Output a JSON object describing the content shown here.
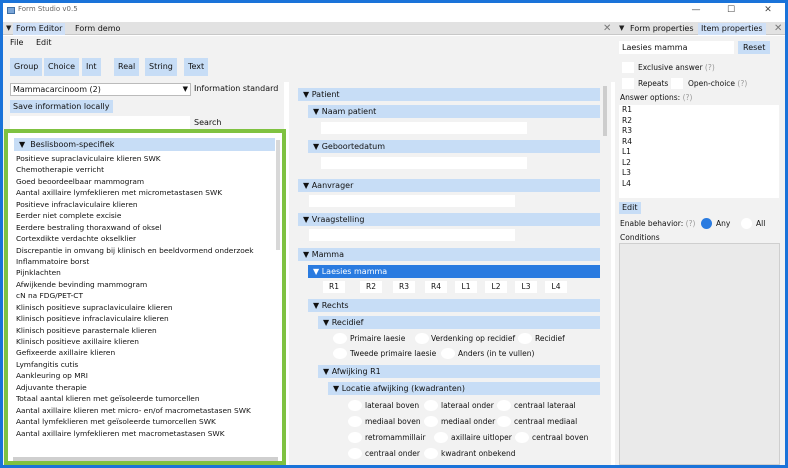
{
  "window": {
    "title": "Form Studio v0.5",
    "minimize": "—",
    "maximize": "☐",
    "close": "✕"
  },
  "left_tabs": {
    "tab1": "Form Editor",
    "tab2": "Form demo",
    "close": "✕"
  },
  "right_tabs": {
    "tab1": "Form properties",
    "tab2": "Item properties",
    "close": "✕"
  },
  "menu": {
    "file": "File",
    "edit": "Edit"
  },
  "toolbar": [
    "Group",
    "Choice",
    "Int",
    "Real",
    "String",
    "Text"
  ],
  "left": {
    "select_value": "Mammacarcinoom (2)",
    "info_standard": "Information standard",
    "save_label": "Save information locally",
    "search_value": "",
    "search_label": "Search",
    "tree_header": "Beslisboom-specifiek",
    "items": [
      "Positieve supraclaviculaire klieren SWK",
      "Chemotherapie verricht",
      "Goed beoordeelbaar mammogram",
      "Aantal axillaire lymfeklieren met micrometastasen SWK",
      "Positieve infraclaviculaire klieren",
      "Eerder niet complete excisie",
      "Eerdere bestraling thoraxwand of oksel",
      "Cortexdikte verdachte okselklier",
      "Discrepantie in omvang bij klinisch en beeldvormend onderzoek",
      "Inflammatoire borst",
      "Pijnklachten",
      "Afwijkende bevinding mammogram",
      "cN na FDG/PET-CT",
      "Klinisch positieve supraclaviculaire klieren",
      "Klinisch positieve infraclaviculaire klieren",
      "Klinisch positieve parasternale klieren",
      "Klinisch positieve axillaire klieren",
      "Gefixeerde axillaire klieren",
      "Lymfangitis cutis",
      "Aankleuring op MRI",
      "Adjuvante therapie",
      "Totaal aantal klieren met geïsoleerde tumorcellen",
      "Aantal axillaire klieren met micro- en/of macrometastasen SWK",
      "Aantal lymfeklieren met geïsoleerde tumorcellen SWK",
      "Aantal axillaire lymfeklieren met macrometastasen SWK"
    ]
  },
  "center": {
    "patient": "Patient",
    "naam": "Naam patient",
    "geboortedatum": "Geboortedatum",
    "aanvrager": "Aanvrager",
    "vraagstelling": "Vraagstelling",
    "mamma": "Mamma",
    "laesies": "Laesies mamma",
    "r_buttons": [
      "R1",
      "R2",
      "R3",
      "R4",
      "L1",
      "L2",
      "L3",
      "L4"
    ],
    "rechts": "Rechts",
    "recidief": "Recidief",
    "recidief_opts": [
      "Primaire laesie",
      "Verdenking op recidief",
      "Recidief",
      "Tweede primaire laesie",
      "Anders (in te vullen)"
    ],
    "afwijking": "Afwijking R1",
    "locatie": "Locatie afwijking (kwadranten)",
    "locatie_opts": [
      "lateraal boven",
      "lateraal onder",
      "centraal lateraal",
      "mediaal boven",
      "mediaal onder",
      "centraal mediaal",
      "retromammillair",
      "axillaire uitloper",
      "centraal boven",
      "centraal onder",
      "kwadrant onbekend"
    ]
  },
  "right": {
    "name_value": "Laesies mamma",
    "reset": "Reset",
    "exclusive": "Exclusive answer",
    "repeats": "Repeats",
    "open_choice": "Open-choice",
    "help": "(?)",
    "answer_options": "Answer options:",
    "answers": [
      "R1",
      "R2",
      "R3",
      "R4",
      "L1",
      "L2",
      "L3",
      "L4"
    ],
    "edit": "Edit",
    "enable_behavior": "Enable behavior:",
    "any": "Any",
    "all": "All",
    "conditions": "Conditions"
  },
  "colors": {
    "accent": "#1a73d9",
    "tab_active": "#c7ddf6",
    "selected": "#2a7be0",
    "highlight_border": "#7fc241"
  }
}
